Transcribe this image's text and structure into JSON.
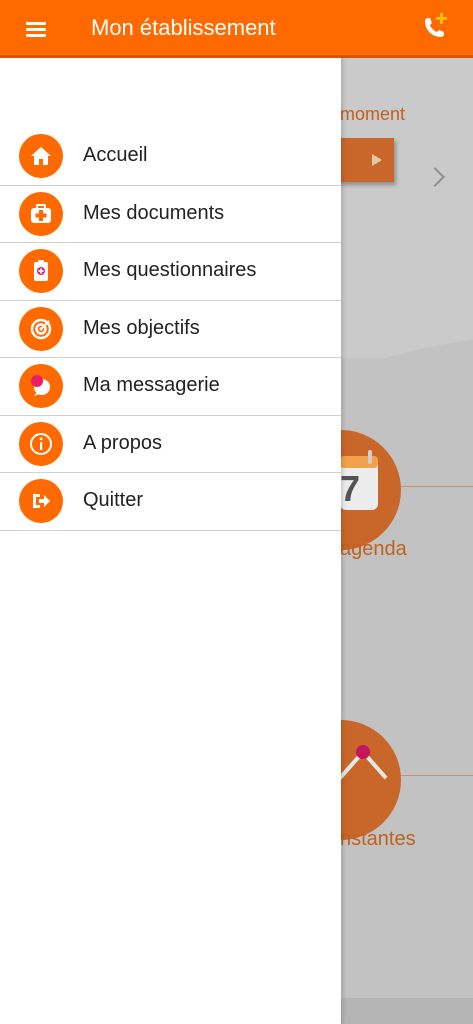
{
  "header": {
    "title": "Mon établissement",
    "menu_icon": "hamburger-menu-icon",
    "call_icon": "phone-plus-icon"
  },
  "colors": {
    "brand": "#ff6a00",
    "brand_dark": "#d95500",
    "overlay": "#c2c2c2",
    "bg_accent": "#c9672a"
  },
  "drawer": {
    "items": [
      {
        "label": "Accueil",
        "icon": "home-icon"
      },
      {
        "label": "Mes documents",
        "icon": "medical-case-icon"
      },
      {
        "label": "Mes questionnaires",
        "icon": "clipboard-icon"
      },
      {
        "label": "Mes objectifs",
        "icon": "target-icon"
      },
      {
        "label": "Ma messagerie",
        "icon": "chat-bubble-icon"
      },
      {
        "label": "A propos",
        "icon": "info-icon"
      },
      {
        "label": "Quitter",
        "icon": "exit-icon"
      }
    ]
  },
  "background": {
    "moment_text": "moment",
    "agenda_label": "agenda",
    "constantes_label": "nstantes",
    "agenda_icon": "calendar-icon",
    "agenda_day": "7",
    "constantes_icon": "chart-line-icon"
  }
}
